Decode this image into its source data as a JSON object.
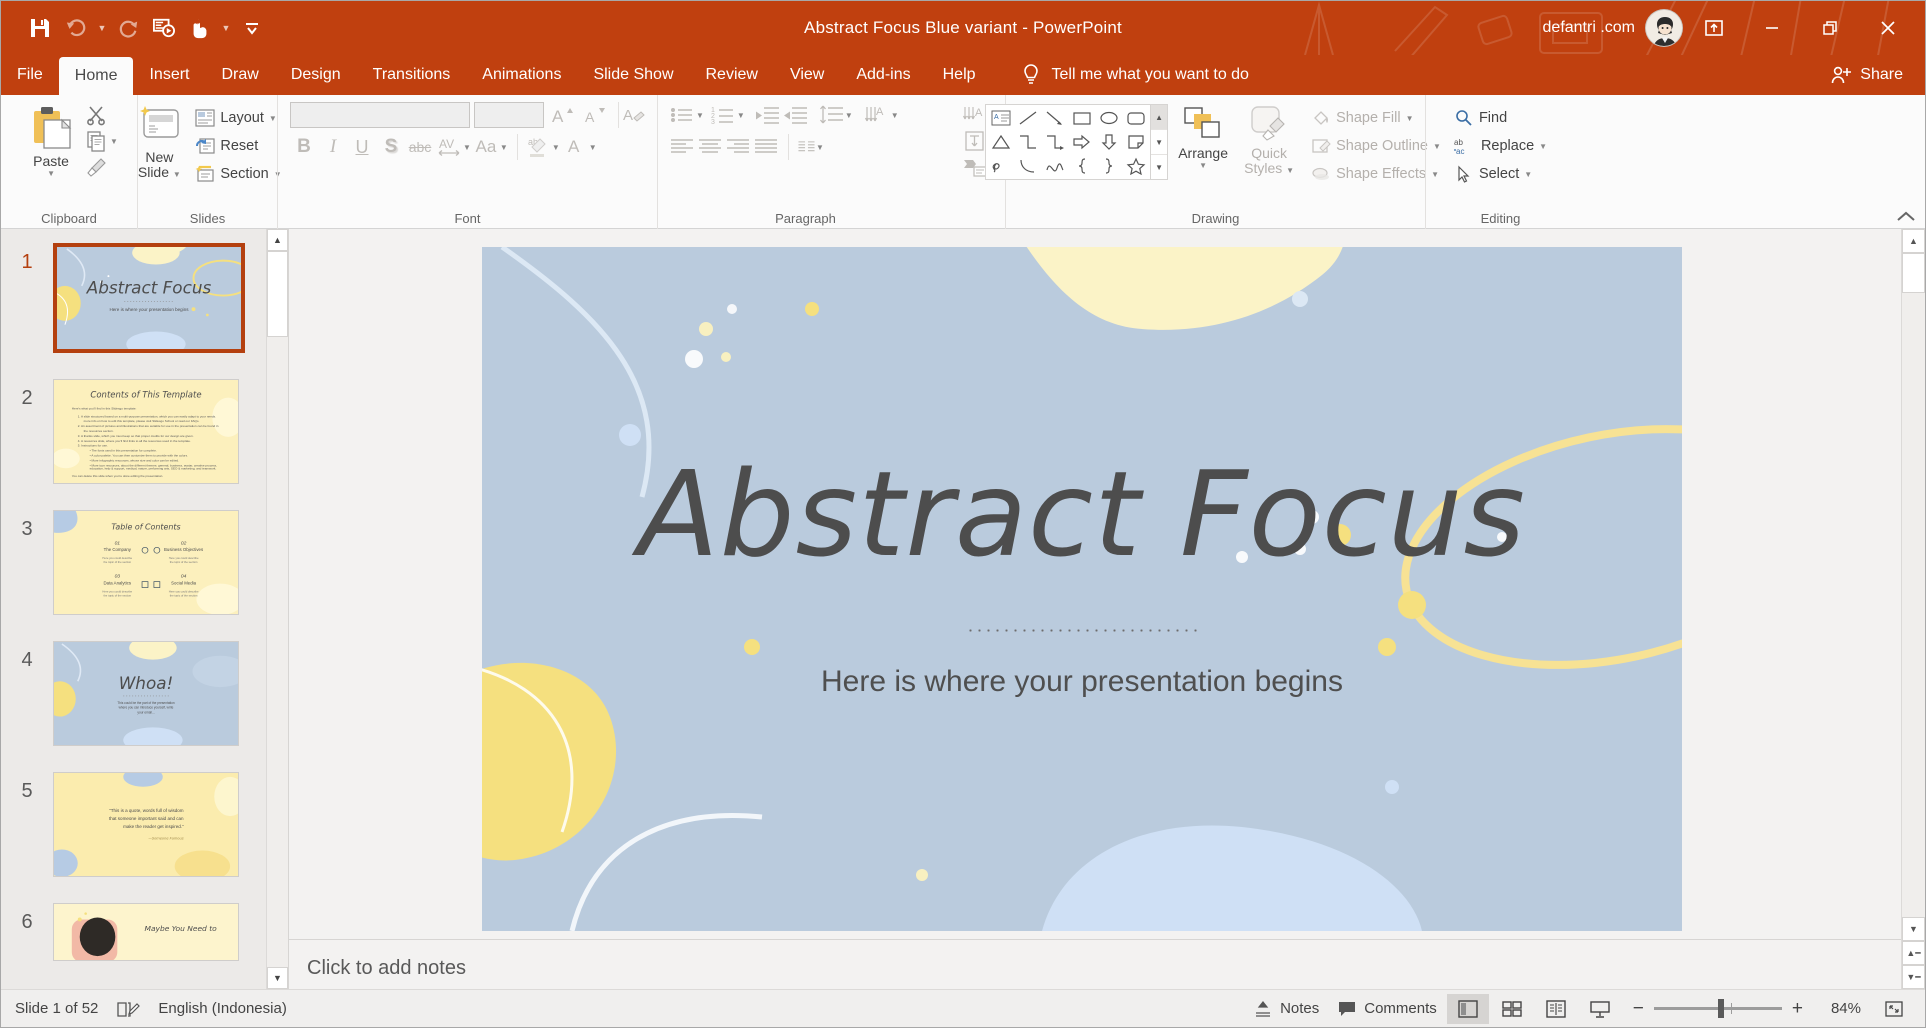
{
  "window": {
    "title": "Abstract Focus Blue variant  -  PowerPoint",
    "user": "defantri .com",
    "accent_color": "#c0400f",
    "quick_access": [
      {
        "name": "save",
        "icon": "save-icon"
      },
      {
        "name": "undo",
        "icon": "undo-icon"
      },
      {
        "name": "redo",
        "icon": "redo-icon"
      },
      {
        "name": "start-from-beginning",
        "icon": "present-icon"
      },
      {
        "name": "touch-mode",
        "icon": "touch-icon"
      },
      {
        "name": "customize-quick-access-toolbar",
        "icon": "chevron-down-icon"
      }
    ],
    "controls": [
      {
        "name": "ribbon-display-options",
        "glyph": "⬆"
      },
      {
        "name": "minimize",
        "glyph": "—"
      },
      {
        "name": "restore",
        "glyph": "❐"
      },
      {
        "name": "close",
        "glyph": "✕"
      }
    ]
  },
  "tabs": [
    {
      "label": "File",
      "active": false
    },
    {
      "label": "Home",
      "active": true
    },
    {
      "label": "Insert",
      "active": false
    },
    {
      "label": "Draw",
      "active": false
    },
    {
      "label": "Design",
      "active": false
    },
    {
      "label": "Transitions",
      "active": false
    },
    {
      "label": "Animations",
      "active": false
    },
    {
      "label": "Slide Show",
      "active": false
    },
    {
      "label": "Review",
      "active": false
    },
    {
      "label": "View",
      "active": false
    },
    {
      "label": "Add-ins",
      "active": false
    },
    {
      "label": "Help",
      "active": false
    }
  ],
  "tell_me": "Tell me what you want to do",
  "share": "Share",
  "ribbon": {
    "groups": [
      {
        "label": "Clipboard"
      },
      {
        "label": "Slides"
      },
      {
        "label": "Font"
      },
      {
        "label": "Paragraph"
      },
      {
        "label": "Drawing"
      },
      {
        "label": "Editing"
      }
    ],
    "clipboard": {
      "paste": "Paste",
      "cut": "cut-icon",
      "copy": "copy-icon",
      "format_painter": "format-painter-icon"
    },
    "slides": {
      "new_slide": "New\nSlide",
      "new_slide_line1": "New",
      "new_slide_line2": "Slide",
      "layout": "Layout",
      "reset": "Reset",
      "section": "Section"
    },
    "font": {
      "font_name_value": "",
      "font_name_placeholder": "",
      "font_size_value": "",
      "increase_font": "A",
      "decrease_font": "A",
      "clear_formatting": "clear-formatting-icon",
      "bold": "B",
      "italic": "I",
      "underline": "U",
      "shadow": "S",
      "strikethrough": "abc",
      "character_spacing": "AV",
      "change_case": "Aa",
      "text_highlight": "text-highlight-icon",
      "font_color": "A"
    },
    "drawing": {
      "arrange": "Arrange",
      "quick_styles_line1": "Quick",
      "quick_styles_line2": "Styles",
      "shape_fill": "Shape Fill",
      "shape_outline": "Shape Outline",
      "shape_effects": "Shape Effects"
    },
    "editing": {
      "find": "Find",
      "replace": "Replace",
      "select": "Select"
    }
  },
  "slide_panel": {
    "slides": [
      {
        "number": "1",
        "title": "Abstract Focus",
        "subtitle": "Here is where your presentation begins",
        "style": "title-blue",
        "selected": true
      },
      {
        "number": "2",
        "title": "Contents of This Template",
        "style": "content-cream",
        "selected": false
      },
      {
        "number": "3",
        "title": "Table of Contents",
        "style": "toc-cream",
        "selected": false,
        "sections": [
          {
            "num": "01",
            "name": "The Company",
            "desc": "Here you could describe the topic of the section"
          },
          {
            "num": "02",
            "name": "Business Objectives",
            "desc": "Here you could describe the topic of the section"
          },
          {
            "num": "03",
            "name": "Data Analytics",
            "desc": "Here you could describe the topic of the section"
          },
          {
            "num": "04",
            "name": "Social Media",
            "desc": "Here you could describe the topic of the section"
          }
        ]
      },
      {
        "number": "4",
        "title": "Whoa!",
        "subtitle": "This could be the part of the presentation where you can introduce yourself, write your email...",
        "style": "title-blue",
        "selected": false
      },
      {
        "number": "5",
        "title": "“This is a quote, words full of wisdom that someone important said and can make the reader get inspired.”",
        "attribution": "—Someone Famous",
        "style": "quote-cream",
        "selected": false
      },
      {
        "number": "6",
        "title": "Maybe You Need to",
        "style": "photo-cream",
        "selected": false
      }
    ]
  },
  "slide_canvas": {
    "title": "Abstract Focus",
    "subtitle": "Here is where your presentation begins",
    "background_color": "#bacbdd",
    "blob_cream": "#fbf3c7",
    "blob_yellow": "#f5e07f",
    "blob_lightblue": "#cfe0f5",
    "title_color": "#4d4d4d"
  },
  "notes_placeholder": "Click to add notes",
  "status_bar": {
    "slide_count": "Slide 1 of 52",
    "accessibility_icon": "accessibility-check-icon",
    "language": "English (Indonesia)",
    "notes": "Notes",
    "comments": "Comments",
    "views": [
      {
        "name": "normal-view",
        "active": true
      },
      {
        "name": "slide-sorter-view",
        "active": false
      },
      {
        "name": "reading-view",
        "active": false
      },
      {
        "name": "slide-show-view",
        "active": false
      }
    ],
    "zoom_out": "−",
    "zoom_in": "+",
    "zoom_value": "84%",
    "fit_to_window": "fit-slide-icon"
  }
}
